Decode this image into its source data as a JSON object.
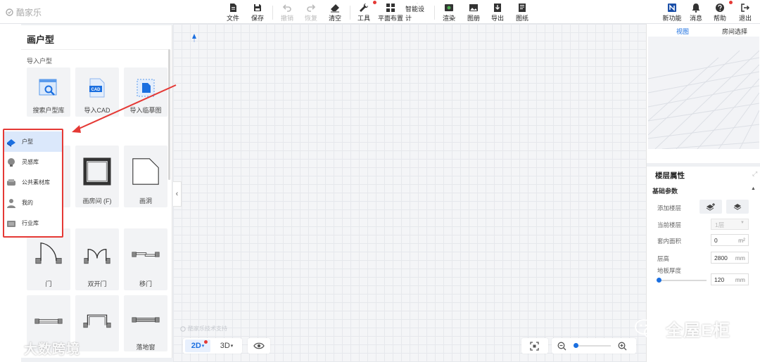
{
  "app": {
    "logo_text": "酷家乐"
  },
  "toolbar": {
    "file": "文件",
    "save": "保存",
    "undo": "撤销",
    "redo": "恢复",
    "clear": "清空",
    "tools": "工具",
    "layout": "平面布置",
    "smart_design": "智能设计",
    "render": "渲染",
    "gallery": "图册",
    "export": "导出",
    "drawings": "图纸",
    "new_features": "新功能",
    "messages": "消息",
    "help": "帮助",
    "exit": "退出"
  },
  "left_panel": {
    "title": "画户型",
    "import_section": "导入户型",
    "import_cards": [
      "搜索户型库",
      "导入CAD",
      "导入临摹图"
    ],
    "room_cards": [
      "画房间 (F)",
      "画洞"
    ],
    "door_cards": [
      "门",
      "双开门",
      "移门"
    ],
    "window_cards": [
      "落地窗"
    ]
  },
  "library_menu": {
    "items": [
      "户型",
      "灵感库",
      "公共素材库",
      "我的",
      "行业库"
    ],
    "selected": "户型"
  },
  "right_panel": {
    "tabs": [
      "视图",
      "房间选择"
    ],
    "active_tab": "视图",
    "floor_title": "楼层属性",
    "basic_params": "基础参数",
    "add_floor": "添加楼层",
    "current_floor": "当前楼层",
    "current_floor_value": "1层",
    "inner_area": "套内面积",
    "inner_area_value": "0",
    "inner_area_unit": "m²",
    "floor_height": "层高",
    "floor_height_value": "2800",
    "floor_height_unit": "mm",
    "slab_thickness": "地板厚度",
    "slab_thickness_value": "120",
    "slab_thickness_unit": "mm"
  },
  "canvas": {
    "support_text": "酷家乐技术支持"
  },
  "bottom_bar": {
    "view_2d": "2D",
    "view_3d": "3D"
  },
  "watermarks": {
    "left": "大数跨境",
    "right": "全屋E柜"
  },
  "colors": {
    "accent": "#1b6fe0",
    "highlight": "#e53935",
    "panel_bg": "#ffffff"
  }
}
